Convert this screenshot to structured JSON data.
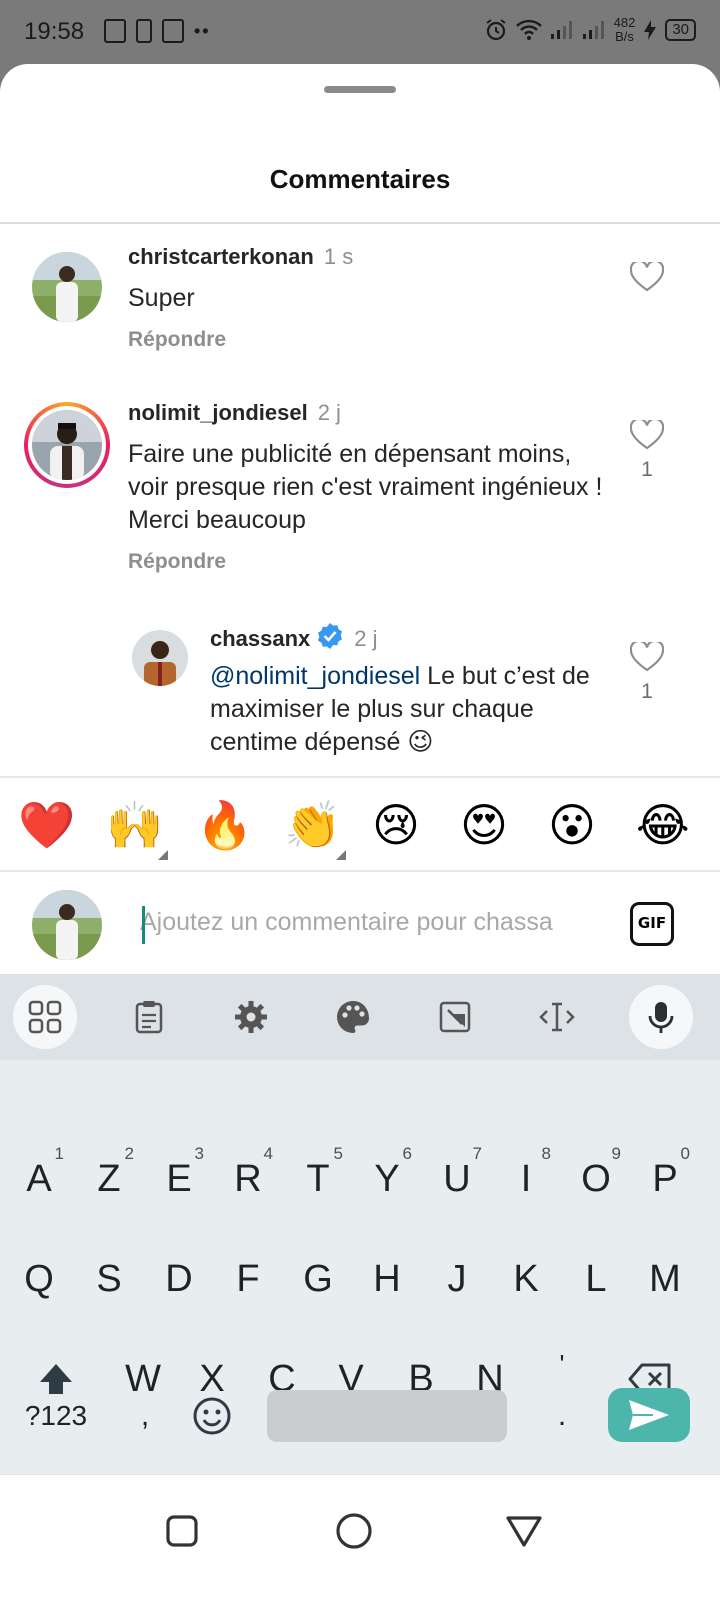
{
  "status_bar": {
    "time": "19:58",
    "net_speed_value": "482",
    "net_speed_unit": "B/s",
    "battery": "30",
    "left_icons": [
      "image-icon",
      "battery-alert-icon",
      "sim-icon",
      "more-dots-icon"
    ],
    "right_icons": [
      "alarm-icon",
      "wifi-icon",
      "signal-icon",
      "signal-icon",
      "charging-icon"
    ]
  },
  "sheet": {
    "title": "Commentaires"
  },
  "comments": [
    {
      "username": "christcarterkonan",
      "time": "1 s",
      "text": "Super",
      "reply_label": "Répondre",
      "likes": ""
    },
    {
      "username": "nolimit_jondiesel",
      "time": "2 j",
      "text": "Faire une publicité en dépensant moins, voir presque rien c'est vraiment ingénieux ! Merci beaucoup",
      "reply_label": "Répondre",
      "likes": "1"
    },
    {
      "username": "chassanx",
      "time": "2 j",
      "verified": true,
      "mention": "@nolimit_jondiesel",
      "text": " Le but c’est de maximiser le plus sur chaque centime dépensé 😉",
      "likes": "1"
    }
  ],
  "emoji_bar": [
    "❤️",
    "🙌",
    "🔥",
    "👏",
    "😢",
    "😍",
    "😮",
    "😂"
  ],
  "composer": {
    "placeholder": "Ajoutez un commentaire pour chassa",
    "gif_label": "GIF"
  },
  "keyboard": {
    "row1": [
      {
        "key": "A",
        "hint": "1"
      },
      {
        "key": "Z",
        "hint": "2"
      },
      {
        "key": "E",
        "hint": "3"
      },
      {
        "key": "R",
        "hint": "4"
      },
      {
        "key": "T",
        "hint": "5"
      },
      {
        "key": "Y",
        "hint": "6"
      },
      {
        "key": "U",
        "hint": "7"
      },
      {
        "key": "I",
        "hint": "8"
      },
      {
        "key": "O",
        "hint": "9"
      },
      {
        "key": "P",
        "hint": "0"
      }
    ],
    "row2": [
      "Q",
      "S",
      "D",
      "F",
      "G",
      "H",
      "J",
      "K",
      "L",
      "M"
    ],
    "row3": [
      "W",
      "X",
      "C",
      "V",
      "B",
      "N",
      "'"
    ],
    "symbols_label": "?123",
    "comma": ",",
    "period": "."
  },
  "colors": {
    "accent_send": "#4db6ac",
    "mention": "#00376b",
    "verified": "#3897f0",
    "heart_outline": "#8e8e8e"
  }
}
